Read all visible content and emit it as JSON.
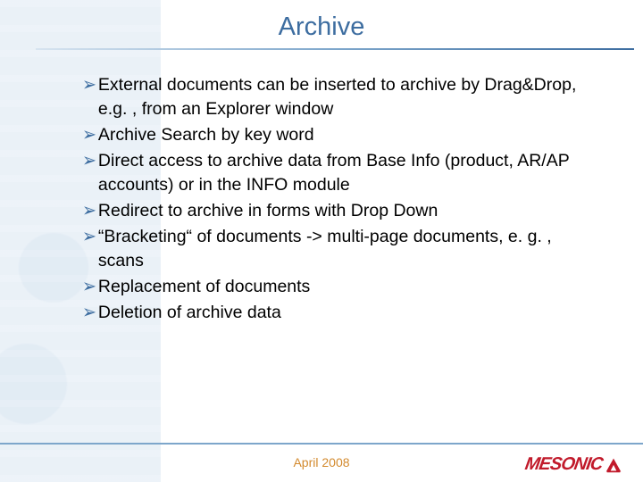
{
  "title": "Archive",
  "bullets": [
    "External documents can be inserted to archive by Drag&Drop, e.g. , from an Explorer window",
    "Archive Search by key word",
    "Direct access to archive data from Base Info (product, AR/AP accounts) or in the INFO module",
    "Redirect to archive in forms with Drop Down",
    "“Bracketing“ of documents -> multi-page documents, e. g. , scans",
    "Replacement of documents",
    "Deletion of archive data"
  ],
  "footer": {
    "date": "April 2008",
    "brand": "MESONIC"
  },
  "colors": {
    "accent": "#3d6da0",
    "brand": "#c11a2b",
    "date": "#d38a2e"
  }
}
